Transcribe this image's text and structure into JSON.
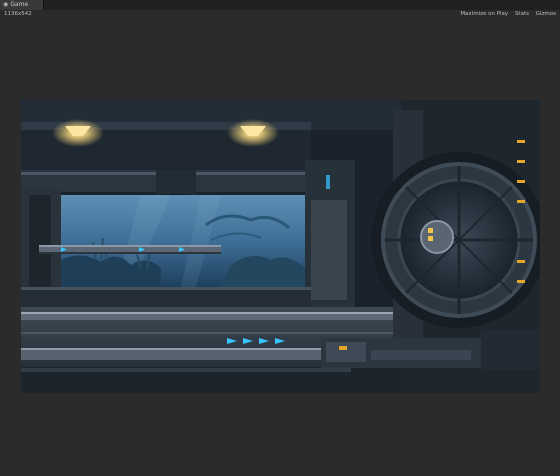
{
  "tab": {
    "icon": "game-view-icon",
    "label": "Game"
  },
  "toolbar": {
    "resolution": "1136x542",
    "maximize_on_play": "Maximize on Play",
    "stats": "Stats",
    "gizmos": "Gizmos"
  },
  "colors": {
    "editor_bg": "#2b2b2b",
    "tab_bg": "#393939",
    "accent_light": "#f2d37a",
    "arrow_blue": "#37c6ff"
  }
}
